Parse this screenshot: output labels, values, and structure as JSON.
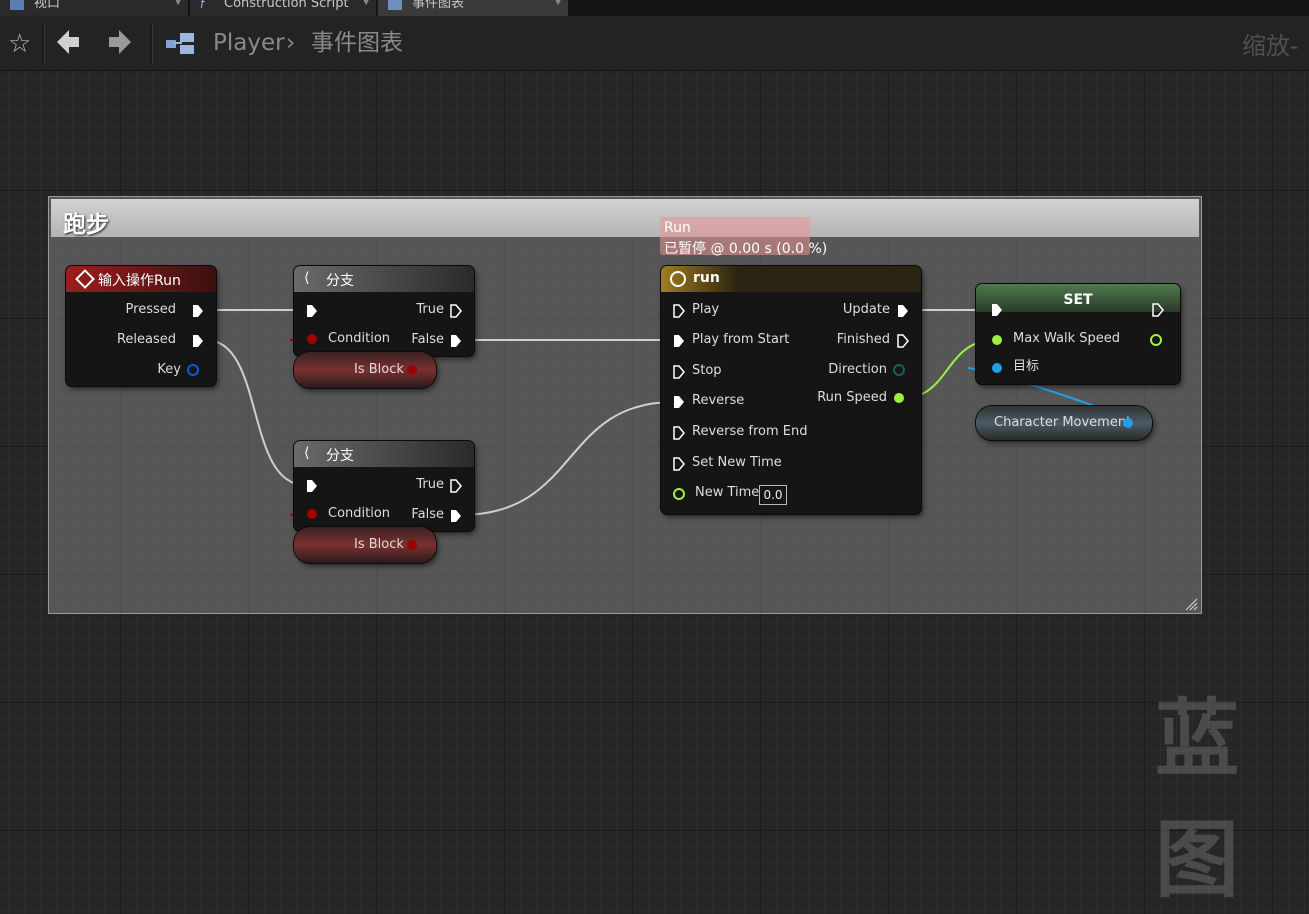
{
  "tabs": [
    {
      "label": "视口"
    },
    {
      "label": "Construction Script"
    },
    {
      "label": "事件图表"
    }
  ],
  "breadcrumb": {
    "root": "Player",
    "separator": "›",
    "current": "事件图表"
  },
  "zoom_label": "缩放-",
  "comment": {
    "title": "跑步"
  },
  "tooltip": {
    "line1": "Run",
    "line2": "已暂停 @ 0.00 s (0.0 %)"
  },
  "nodes": {
    "input_action": {
      "title": "输入操作Run",
      "pins": {
        "pressed": "Pressed",
        "released": "Released",
        "key": "Key"
      }
    },
    "branch1": {
      "title": "分支",
      "pins": {
        "true": "True",
        "condition": "Condition",
        "false": "False"
      },
      "var": "Is Block"
    },
    "branch2": {
      "title": "分支",
      "pins": {
        "true": "True",
        "condition": "Condition",
        "false": "False"
      },
      "var": "Is Block"
    },
    "timeline": {
      "title": "run",
      "inputs": [
        "Play",
        "Play from Start",
        "Stop",
        "Reverse",
        "Reverse from End",
        "Set New Time"
      ],
      "new_time_label": "New Time",
      "new_time_value": "0.0",
      "outputs": {
        "update": "Update",
        "finished": "Finished",
        "direction": "Direction",
        "run_speed": "Run Speed"
      }
    },
    "set": {
      "title": "SET",
      "pins": {
        "max_walk_speed": "Max Walk Speed",
        "target": "目标"
      }
    },
    "char_movement": {
      "label": "Character Movement"
    }
  },
  "watermark": "蓝图",
  "colors": {
    "exec": "#ffffff",
    "bool": "#a00000",
    "float": "#9cf141",
    "object": "#1ea0e8",
    "struct": "#0a5ae0",
    "event_head": "#9c1e1e",
    "timeline_head": "#a07c1e",
    "set_head": "#4e9a4e"
  }
}
